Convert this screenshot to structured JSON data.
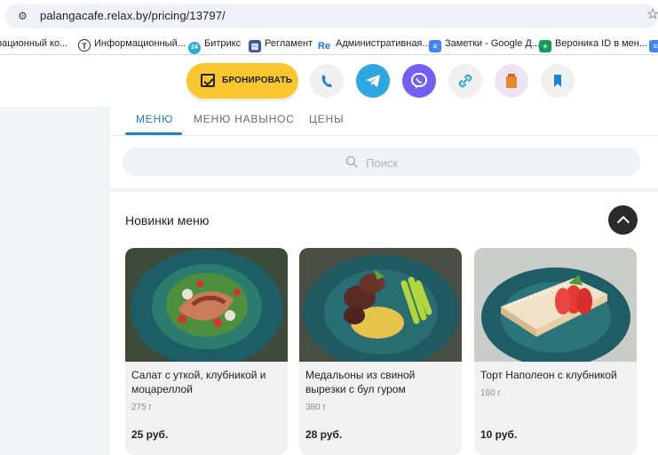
{
  "browser": {
    "url": "palangacafe.relax.by/pricing/13797/"
  },
  "bookmarks": [
    {
      "label": "рационный ко...",
      "icon": "none",
      "color": "#ffffff"
    },
    {
      "label": "Информационный...",
      "icon": "t-circle-icon",
      "color": "#ffffff"
    },
    {
      "label": "Битрикс",
      "icon": "bitrix24-icon",
      "color": "#2fa8e0"
    },
    {
      "label": "Регламент",
      "icon": "table-icon",
      "color": "#3b5998"
    },
    {
      "label": "Административная...",
      "icon": "re-icon",
      "color": "#1a73e8"
    },
    {
      "label": "Заметки - Google Д...",
      "icon": "docs-icon",
      "color": "#4285f4"
    },
    {
      "label": "Вероника ID в мен...",
      "icon": "sheets-plus-icon",
      "color": "#0f9d58"
    }
  ],
  "header": {
    "book_label": "БРОНИРОВАТЬ",
    "contact_icons": [
      "phone-icon",
      "telegram-icon",
      "viber-icon",
      "link-icon",
      "bag-icon",
      "bookmark-icon"
    ]
  },
  "tabs": [
    {
      "label": "МЕНЮ",
      "active": true
    },
    {
      "label": "МЕНЮ НАВЫНОС",
      "active": false
    },
    {
      "label": "ЦЕНЫ",
      "active": false
    }
  ],
  "search": {
    "placeholder": "Поиск"
  },
  "section": {
    "title": "Новинки меню"
  },
  "items": [
    {
      "name": "Салат с уткой, клубникой и моцареллой",
      "weight": "275 г",
      "price": "25 руб."
    },
    {
      "name": "Медальоны из свиной вырезки с бул гуром",
      "weight": "380 г",
      "price": "28 руб."
    },
    {
      "name": "Торт Наполеон с клубникой",
      "weight": "160 г",
      "price": "10 руб."
    }
  ]
}
